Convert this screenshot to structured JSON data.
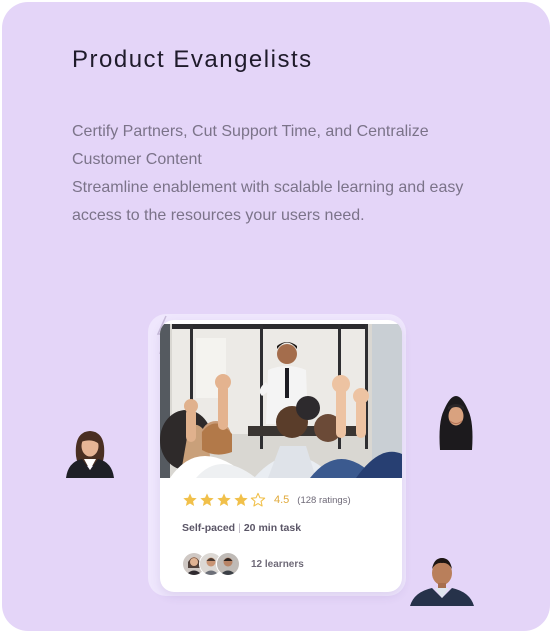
{
  "section": {
    "title": "Product Evangelists",
    "description_line1": "Certify Partners, Cut Support Time, and Centralize Customer Content",
    "description_line2": "Streamline enablement with scalable learning and easy access to the resources your users need."
  },
  "course_card": {
    "rating": {
      "value": "4.5",
      "count_label": "(128 ratings)",
      "stars_filled": 4,
      "stars_total": 5,
      "star_color": "#f1c04a"
    },
    "pace_label": "Self-paced",
    "separator": "|",
    "duration_label": "20 min task",
    "learners_label": "12 learners"
  },
  "colors": {
    "panel_background": "#e4d5f8",
    "title": "#1f1b2b",
    "body_text": "#7b7389",
    "rating_text": "#e0a93a"
  }
}
